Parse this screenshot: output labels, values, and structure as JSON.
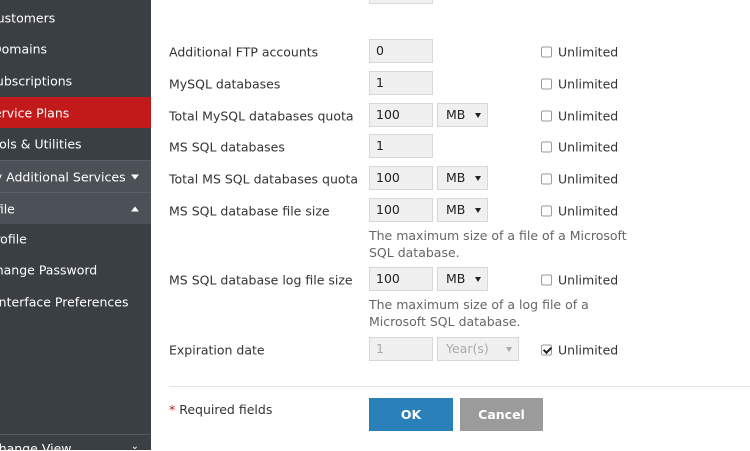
{
  "sidebar": {
    "items": [
      {
        "label": "Customers",
        "state": "normal"
      },
      {
        "label": "Domains",
        "state": "normal"
      },
      {
        "label": "Subscriptions",
        "state": "normal"
      },
      {
        "label": "Service Plans",
        "state": "active"
      },
      {
        "label": "Tools & Utilities",
        "state": "normal"
      },
      {
        "label": "My Additional Services",
        "state": "section"
      },
      {
        "label": "Profile",
        "state": "section"
      },
      {
        "label": "Profile",
        "state": "normal"
      },
      {
        "label": "Change Password",
        "state": "normal"
      },
      {
        "label": "Interface Preferences",
        "state": "normal"
      }
    ],
    "bottom": {
      "label": "Change View",
      "icon": "chevron-down-icon"
    }
  },
  "form": {
    "rows": [
      {
        "label": "Additional FTP accounts",
        "value": "0",
        "unlimited": "Unlimited",
        "checked": false
      },
      {
        "label": "MySQL databases",
        "value": "1",
        "unlimited": "Unlimited",
        "checked": false
      },
      {
        "label": "Total MySQL databases quota",
        "value": "100",
        "unit": "MB",
        "unlimited": "Unlimited",
        "checked": false
      },
      {
        "label": "MS SQL databases",
        "value": "1",
        "unlimited": "Unlimited",
        "checked": false
      },
      {
        "label": "Total MS SQL databases quota",
        "value": "100",
        "unit": "MB",
        "unlimited": "Unlimited",
        "checked": false
      },
      {
        "label": "MS SQL database file size",
        "value": "100",
        "unit": "MB",
        "unlimited": "Unlimited",
        "checked": false,
        "hint": "The maximum size of a file of a Microsoft SQL database."
      },
      {
        "label": "MS SQL database log file size",
        "value": "100",
        "unit": "MB",
        "unlimited": "Unlimited",
        "checked": false,
        "hint": "The maximum size of a log file of a Microsoft SQL database."
      },
      {
        "label": "Expiration date",
        "value": "1",
        "unit": "Year(s)",
        "unlimited": "Unlimited",
        "checked": true
      }
    ],
    "required_note": "Required fields",
    "required_star": "*",
    "ok_label": "OK",
    "cancel_label": "Cancel"
  },
  "colors": {
    "accent": "#c21a1a",
    "ok": "#2a80b9",
    "sidebar": "#3a3f44"
  }
}
